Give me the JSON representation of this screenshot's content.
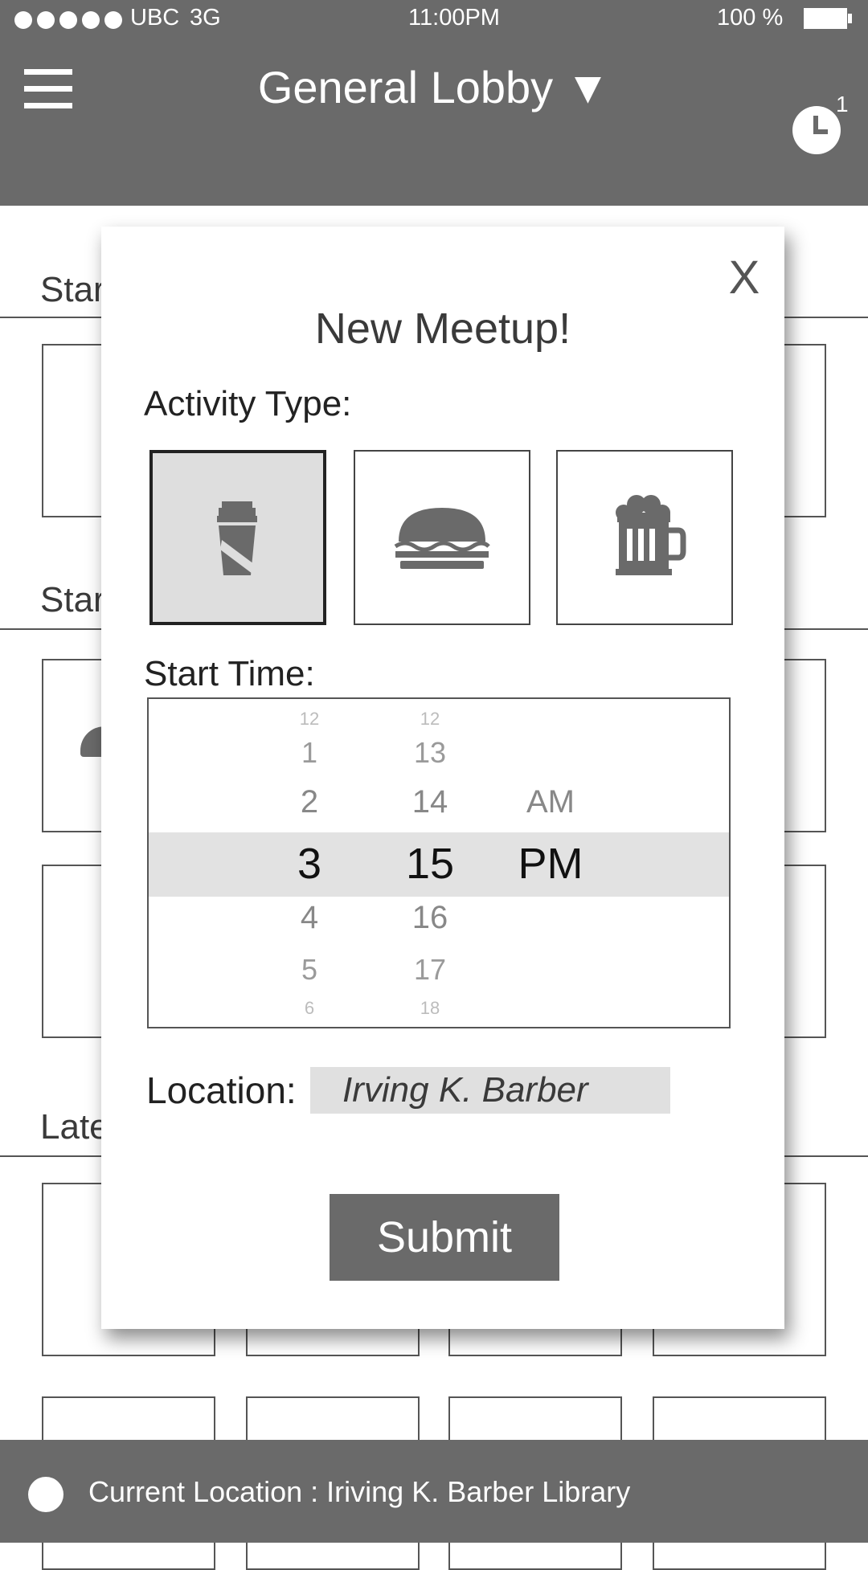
{
  "status_bar": {
    "carrier": "UBC",
    "network": "3G",
    "time": "11:00PM",
    "battery": "100 %"
  },
  "header": {
    "title": "General Lobby ▼",
    "notification_count": "1"
  },
  "background": {
    "sections": [
      {
        "label": "Star"
      },
      {
        "label": "Star"
      },
      {
        "label": "Late"
      }
    ]
  },
  "modal": {
    "close_label": "X",
    "title": "New Meetup!",
    "activity_label": "Activity Type:",
    "activities": [
      {
        "name": "coffee-icon",
        "selected": true
      },
      {
        "name": "burger-icon",
        "selected": false
      },
      {
        "name": "beer-mug-icon",
        "selected": false
      }
    ],
    "start_time_label": "Start Time:",
    "picker": {
      "hours": [
        "12",
        "1",
        "2",
        "3",
        "4",
        "5",
        "6"
      ],
      "minutes": [
        "12",
        "13",
        "14",
        "15",
        "16",
        "17",
        "18"
      ],
      "meridiem": [
        "AM",
        "PM"
      ],
      "selected": {
        "hour": "3",
        "minute": "15",
        "meridiem": "PM"
      }
    },
    "location_label": "Location:",
    "location_value": "Irving K. Barber",
    "submit_label": "Submit"
  },
  "footer": {
    "current_location": "Current Location : Iriving K. Barber Library"
  },
  "colors": {
    "bar": "#6a6a6a",
    "selected_bg": "#dedede",
    "field_bg": "#e0e0e0"
  }
}
